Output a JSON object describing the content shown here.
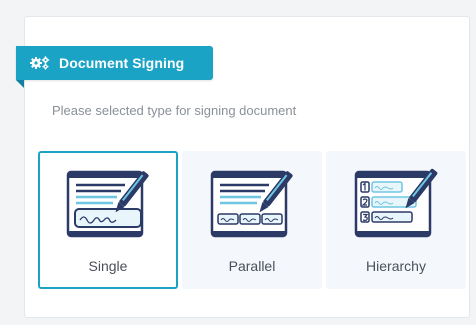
{
  "header": {
    "title": "Document Signing",
    "icon": "gears-icon"
  },
  "subtitle": "Please selected type for signing document",
  "options": [
    {
      "label": "Single",
      "selected": true,
      "icon": "single-sign-document-icon"
    },
    {
      "label": "Parallel",
      "selected": false,
      "icon": "parallel-sign-document-icon"
    },
    {
      "label": "Hierarchy",
      "selected": false,
      "icon": "hierarchy-sign-document-icon"
    }
  ],
  "colors": {
    "accent": "#1ba3c6",
    "ink": "#2b3a67",
    "sky": "#6fc6e0"
  }
}
